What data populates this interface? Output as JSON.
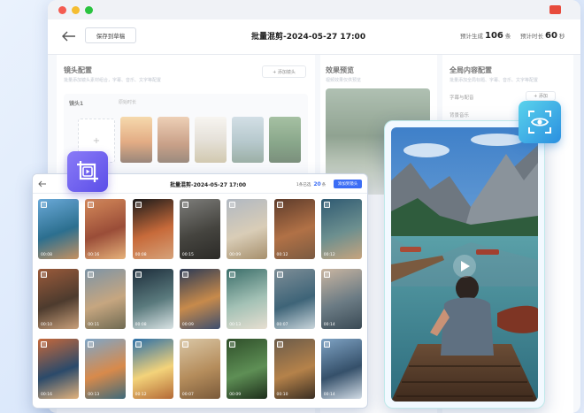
{
  "back_window": {
    "save_button": "保存到草稿",
    "title": "批量混剪-2024-05-27  17:00",
    "stat1_label": "预计生成",
    "stat1_value": "106",
    "stat1_unit": "条",
    "stat2_label": "预计时长",
    "stat2_value": "60",
    "stat2_unit": "秒",
    "lens_title": "镜头配置",
    "lens_desc": "批量添加镜头素材组合，字幕、音乐、文字等配置",
    "add_lens_button": "+ 添加镜头",
    "lens_name": "镜头1",
    "lens_duration": "原始时长",
    "preview_title": "效果预览",
    "preview_desc": "视频效果仅供预览",
    "global_title": "全局内容配置",
    "global_desc": "批量添加全局标题、字幕、音乐、文字等配置",
    "global_item1": "字幕与配音",
    "global_item1_action": "+ 添加",
    "global_item2": "背景音乐",
    "global_item3": "标题"
  },
  "front_window": {
    "title": "批量混剪-2024-05-27  17:00",
    "count_label": "1条已选",
    "count_value": "20",
    "count_unit": "条",
    "confirm_button": "添加到镜头",
    "durations": [
      "00:08",
      "00:16",
      "00:08",
      "00:15",
      "00:09",
      "00:12",
      "00:12",
      "00:10",
      "00:11",
      "00:08",
      "00:09",
      "00:13",
      "00:07",
      "00:14",
      "00:16",
      "00:13",
      "00:12",
      "00:07",
      "00:09",
      "00:10",
      "00:14"
    ]
  },
  "icons": {
    "crop": "crop-frame-icon",
    "scan": "eye-scan-icon",
    "back": "back-arrow-icon",
    "play": "play-icon"
  },
  "colors": {
    "accent": "#3b6df5",
    "scan_badge": "#2fb6e6",
    "crop_badge": "#6a5cf2"
  }
}
